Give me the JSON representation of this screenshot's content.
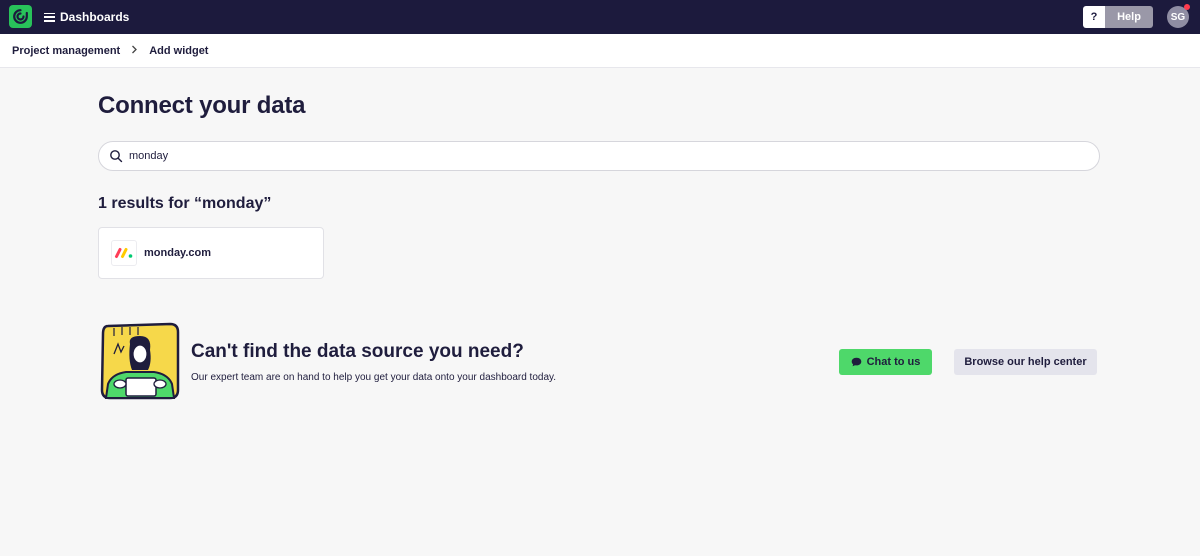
{
  "topbar": {
    "menu_label": "Dashboards",
    "help_question": "?",
    "help_label": "Help",
    "avatar_initials": "SG",
    "brand_color": "#1c1a3d",
    "logo_color": "#28c25a"
  },
  "breadcrumb": {
    "items": [
      "Project management",
      "Add widget"
    ],
    "separator": ">"
  },
  "main": {
    "title": "Connect your data",
    "search": {
      "value": "monday",
      "placeholder": ""
    },
    "results_heading": "1 results for “monday”",
    "results": [
      {
        "name": "monday.com",
        "icon": "monday-logo-icon"
      }
    ]
  },
  "cta": {
    "title": "Can't find the data source you need?",
    "subtitle": "Our expert team are on hand to help you get your data onto your dashboard today.",
    "chat_label": "Chat to us",
    "help_center_label": "Browse our help center",
    "chat_color": "#4ed86a"
  }
}
